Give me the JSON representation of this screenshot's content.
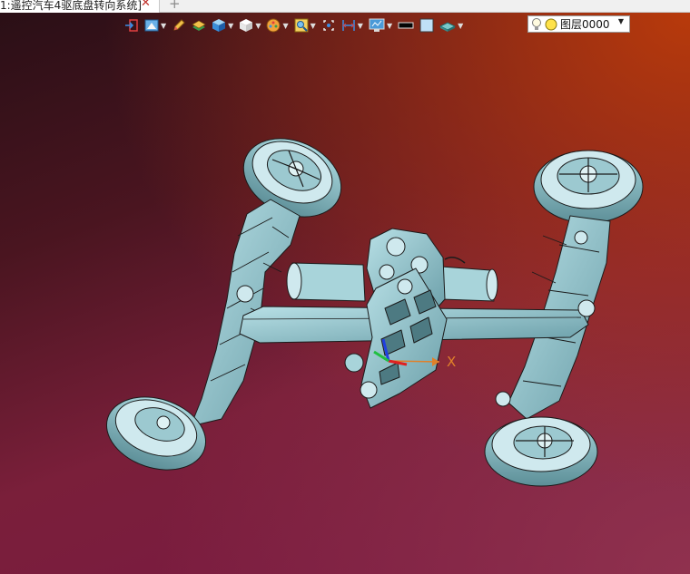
{
  "tab": {
    "title": "1:遥控汽车4驱底盘转向系统]",
    "close_glyph": "✕",
    "add_glyph": "+"
  },
  "toolbar": {
    "items": [
      {
        "icon": "exit-icon"
      },
      {
        "icon": "render-mode-icon"
      },
      {
        "icon": "pencil-icon"
      },
      {
        "icon": "layer-stack-icon"
      },
      {
        "icon": "shaded-cube-icon"
      },
      {
        "icon": "wireframe-cube-icon"
      },
      {
        "icon": "color-wheel-icon"
      },
      {
        "icon": "zoom-view-icon"
      },
      {
        "icon": "fit-view-icon"
      },
      {
        "icon": "dimension-icon"
      },
      {
        "icon": "monitor-icon"
      },
      {
        "icon": "line-color-swatch-icon"
      },
      {
        "icon": "fill-color-swatch-icon"
      },
      {
        "icon": "plane-icon"
      }
    ],
    "caret": "▼"
  },
  "layer_selector": {
    "label": "图层0000",
    "icon": "lightbulb-icon",
    "color": "#ffe24a"
  },
  "axis": {
    "x_label": "X",
    "x_color": "#e0802a"
  },
  "model": {
    "name": "4WD steering chassis assembly",
    "part_color": "#8fc4cc",
    "edge_color": "#1b1b1b"
  }
}
